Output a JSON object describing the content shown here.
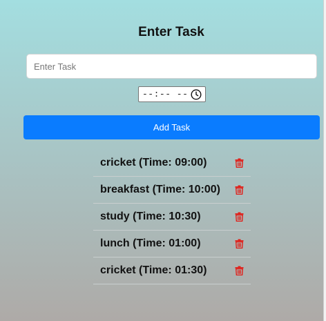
{
  "header": {
    "title": "Enter Task"
  },
  "form": {
    "task_placeholder": "Enter Task",
    "time_value": "--:-- --",
    "add_label": "Add Task"
  },
  "colors": {
    "button": "#0a7cff",
    "delete_icon": "#e0201a",
    "background_top": "#a3dee0",
    "background_bottom": "#aeaaa7"
  },
  "tasks": [
    {
      "label": "cricket (Time: 09:00)"
    },
    {
      "label": "breakfast (Time: 10:00)"
    },
    {
      "label": "study (Time: 10:30)"
    },
    {
      "label": "lunch (Time: 01:00)"
    },
    {
      "label": "cricket (Time: 01:30)"
    }
  ]
}
